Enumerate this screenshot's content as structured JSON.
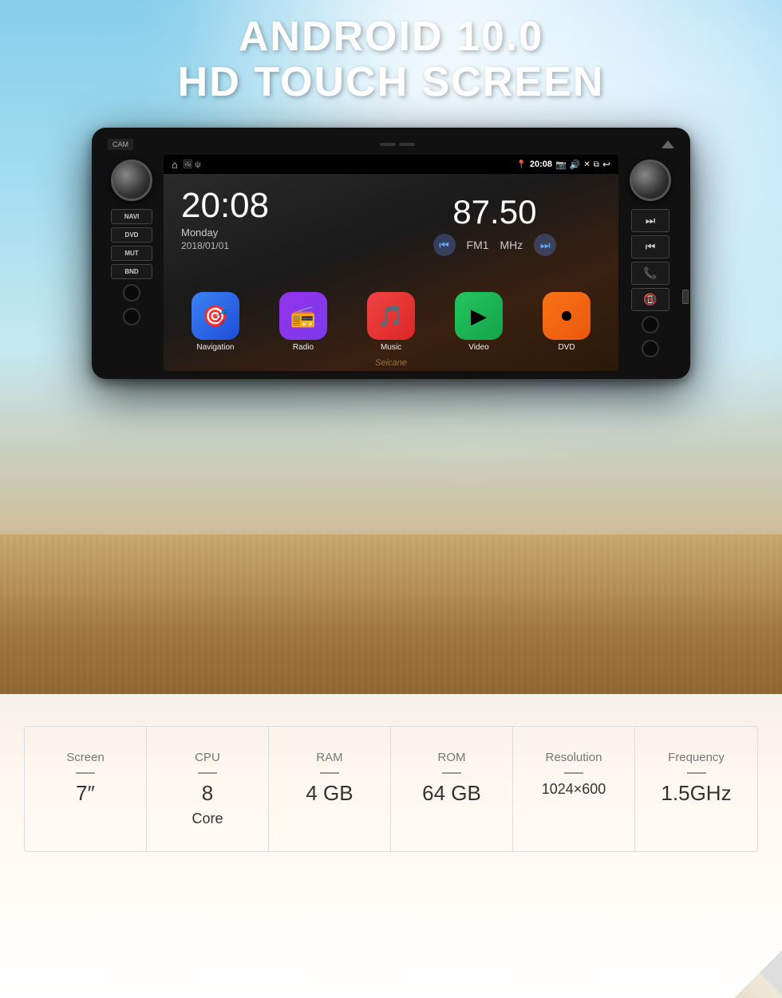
{
  "hero": {
    "title_line1": "ANDROID 10.0",
    "title_line2": "HD TOUCH SCREEN"
  },
  "stereo": {
    "top": {
      "cam_label": "CAM",
      "eject": "▲"
    },
    "left_buttons": [
      "NAVI",
      "DVD",
      "MUT",
      "BND"
    ],
    "screen": {
      "status_bar": {
        "home_icon": "⌂",
        "left_icons": "🖼 ψ",
        "location_icon": "📍",
        "time": "20:08",
        "camera_icon": "📷",
        "volume_icon": "🔊",
        "close_icon": "✕",
        "window_icon": "⧉",
        "back_icon": "↩"
      },
      "clock": {
        "time": "20:08",
        "day": "Monday",
        "date": "2018/01/01"
      },
      "radio": {
        "frequency": "87.50",
        "band": "FM1",
        "unit": "MHz"
      },
      "apps": [
        {
          "name": "Navigation",
          "color": "blue",
          "icon": "🎯"
        },
        {
          "name": "Radio",
          "color": "purple",
          "icon": "📻"
        },
        {
          "name": "Music",
          "color": "red",
          "icon": "🎵"
        },
        {
          "name": "Video",
          "color": "green",
          "icon": "▶"
        },
        {
          "name": "DVD",
          "color": "orange",
          "icon": "⏺"
        }
      ],
      "watermark": "Seicane"
    },
    "right_buttons": {
      "next": "⏭",
      "prev": "⏮",
      "call": "📞",
      "hang_up": "📵"
    }
  },
  "specs": {
    "items": [
      {
        "label": "Screen",
        "divider": "—",
        "value": "7″"
      },
      {
        "label": "CPU",
        "divider": "—",
        "value": "8",
        "sub": "Core"
      },
      {
        "label": "RAM",
        "divider": "—",
        "value": "4 GB"
      },
      {
        "label": "ROM",
        "divider": "—",
        "value": "64 GB"
      },
      {
        "label": "Resolution",
        "divider": "—",
        "value": "1024×600"
      },
      {
        "label": "Frequency",
        "divider": "—",
        "value": "1.5GHz"
      }
    ]
  }
}
